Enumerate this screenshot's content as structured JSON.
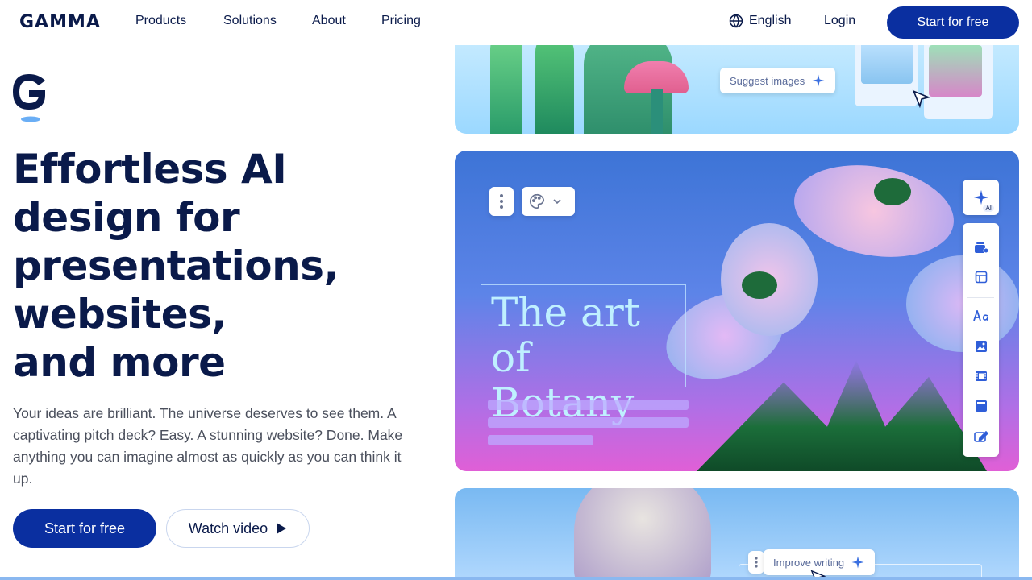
{
  "nav": {
    "logo": "GAMMA",
    "links": [
      "Products",
      "Solutions",
      "About",
      "Pricing"
    ],
    "language": "English",
    "login": "Login",
    "cta": "Start for free"
  },
  "hero": {
    "headline": [
      "Effortless AI",
      "design for",
      "presentations,",
      "websites,",
      "and more"
    ],
    "subtext": "Your ideas are brilliant. The universe deserves to see them. A captivating pitch deck? Easy. A stunning website? Done. Make anything you can imagine almost as quickly as you can think it up.",
    "primary_button": "Start for free",
    "secondary_button": "Watch video"
  },
  "preview": {
    "suggest_images": "Suggest images",
    "slide_title": [
      "The art",
      "of Botany"
    ],
    "ai_badge": "AI",
    "improve_writing": "Improve writing",
    "tools": [
      "add-card-icon",
      "layout-icon",
      "text-icon",
      "image-icon",
      "video-icon",
      "embed-icon",
      "edit-icon"
    ]
  },
  "colors": {
    "brand": "#0a2fa0",
    "heading": "#0a1a4a",
    "body": "#4a4f5c"
  }
}
